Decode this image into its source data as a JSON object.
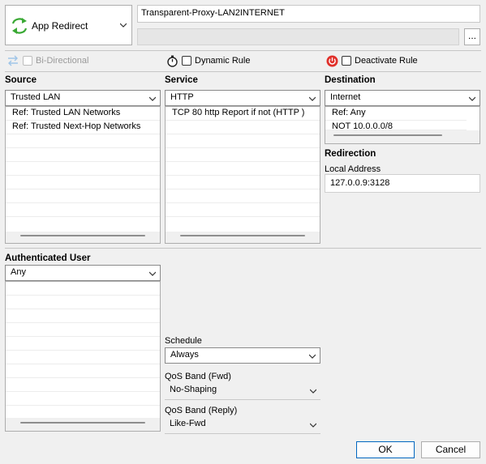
{
  "action": {
    "label": "App Redirect"
  },
  "rule_name": "Transparent-Proxy-LAN2INTERNET",
  "more_button_label": "...",
  "options": {
    "bidirectional": "Bi-Directional",
    "dynamic_rule": "Dynamic Rule",
    "deactivate_rule": "Deactivate Rule"
  },
  "source": {
    "heading": "Source",
    "selected": "Trusted LAN",
    "items": [
      "Ref: Trusted LAN Networks",
      "Ref: Trusted Next-Hop Networks"
    ]
  },
  "service": {
    "heading": "Service",
    "selected": "HTTP",
    "items": [
      "TCP  80 http  Report if not (HTTP )"
    ]
  },
  "destination": {
    "heading": "Destination",
    "selected": "Internet",
    "items": [
      "Ref: Any",
      "NOT 10.0.0.0/8"
    ]
  },
  "redirection": {
    "heading": "Redirection",
    "local_address_label": "Local Address",
    "local_address_value": "127.0.0.9:3128"
  },
  "auth_user": {
    "heading": "Authenticated User",
    "selected": "Any"
  },
  "schedule": {
    "label": "Schedule",
    "selected": "Always"
  },
  "qos_fwd": {
    "label": "QoS Band (Fwd)",
    "selected": "No-Shaping"
  },
  "qos_reply": {
    "label": "QoS Band (Reply)",
    "selected": "Like-Fwd"
  },
  "buttons": {
    "ok": "OK",
    "cancel": "Cancel"
  },
  "colors": {
    "accent_green": "#3aa935",
    "power_red": "#e0302a",
    "ok_border": "#0067c0"
  }
}
